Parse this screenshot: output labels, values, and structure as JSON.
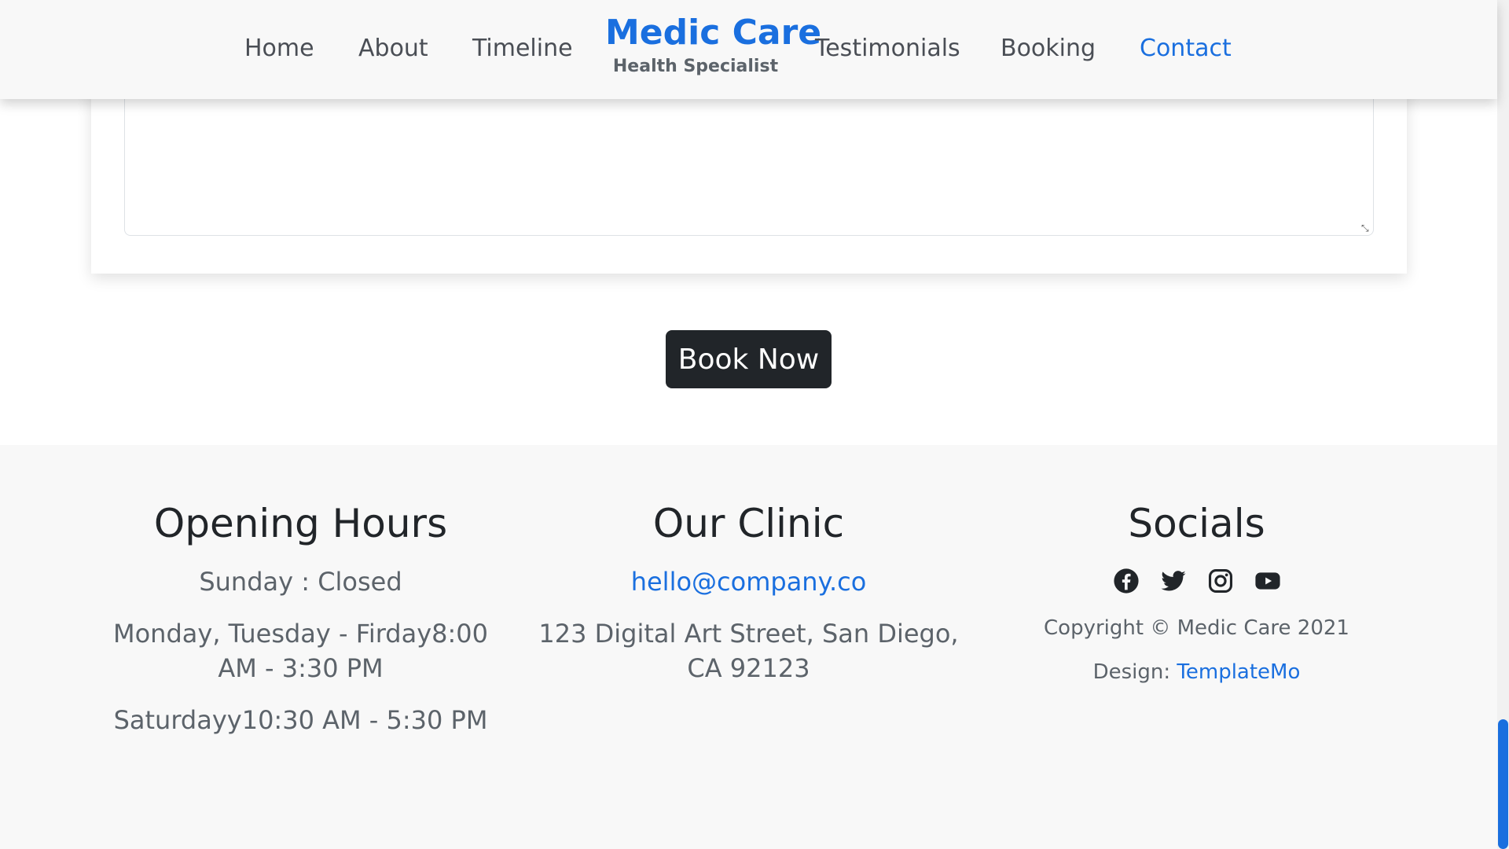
{
  "colors": {
    "brand": "#1a6fdf",
    "dark_button": "#212529",
    "footer_bg": "#f8f8f8"
  },
  "nav": {
    "items": [
      {
        "label": "Home"
      },
      {
        "label": "About"
      },
      {
        "label": "Timeline"
      },
      {
        "label": "Testimonials"
      },
      {
        "label": "Booking"
      },
      {
        "label": "Contact",
        "active": true
      }
    ],
    "brand_title": "Medic Care",
    "brand_subtitle": "Health Specialist"
  },
  "form": {
    "message_value": ""
  },
  "book_button": {
    "label": "Book Now"
  },
  "footer": {
    "hours": {
      "heading": "Opening Hours",
      "lines": [
        "Sunday : Closed",
        "Monday, Tuesday - Firday8:00 AM - 3:30 PM",
        "Saturdayy10:30 AM - 5:30 PM"
      ]
    },
    "clinic": {
      "heading": "Our Clinic",
      "email": "hello@company.co",
      "address": "123 Digital Art Street, San Diego, CA 92123"
    },
    "socials": {
      "heading": "Socials",
      "icons": [
        "facebook-icon",
        "twitter-icon",
        "instagram-icon",
        "youtube-icon"
      ],
      "copyright": "Copyright © Medic Care 2021",
      "design_label": "Design:",
      "design_link": "TemplateMo"
    }
  }
}
